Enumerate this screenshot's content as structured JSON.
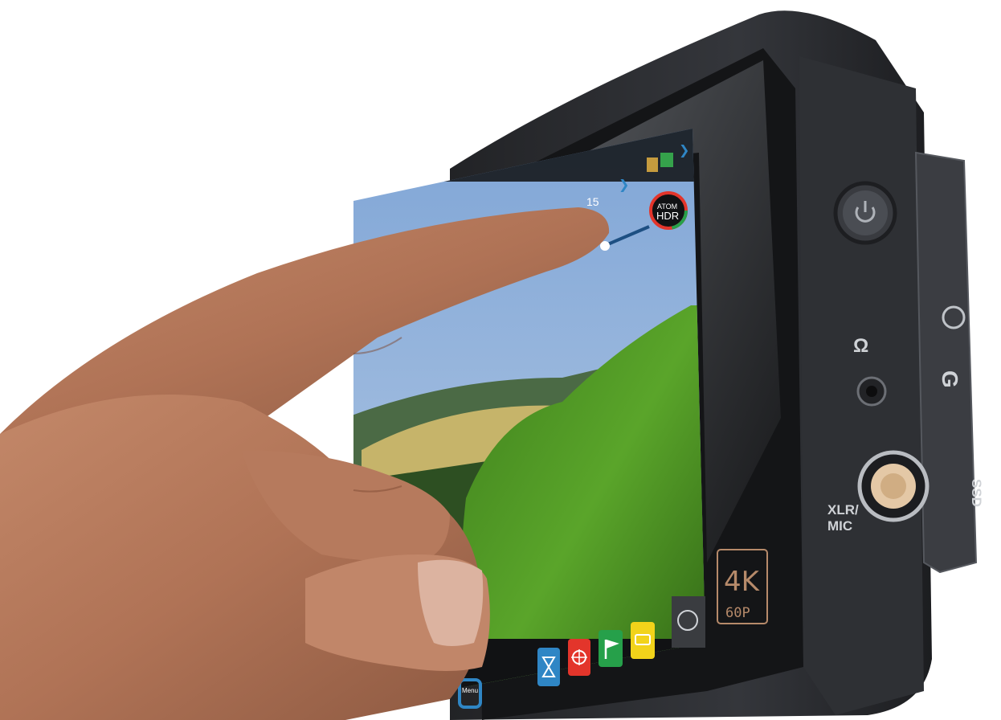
{
  "device": {
    "badge": "ATOM HDR",
    "badge_line1": "ATOM",
    "badge_line2": "HDR",
    "resolution_badge": {
      "line1": "4K",
      "line2": "60P"
    },
    "mic_label_line1": "XLR/",
    "mic_label_line2": "MIC",
    "ssd_label": "SSD",
    "status_text": "15",
    "menu_label": "Menu",
    "colors": {
      "body": "#2b2d31",
      "bezel": "#1b1c1f",
      "accent_blue": "#2f86c5",
      "accent_red": "#e3352b",
      "accent_green": "#26a04a",
      "accent_yellow": "#f2d31a"
    }
  },
  "toolbar": {
    "buttons": [
      {
        "name": "atomos-logo-icon",
        "color": "#3a3c40"
      },
      {
        "name": "timelapse-icon",
        "color": "#2f86c5"
      },
      {
        "name": "crosshair-icon",
        "color": "#e3352b"
      },
      {
        "name": "flag-icon",
        "color": "#26a04a"
      },
      {
        "name": "keyboard-icon",
        "color": "#f2d31a"
      }
    ]
  }
}
